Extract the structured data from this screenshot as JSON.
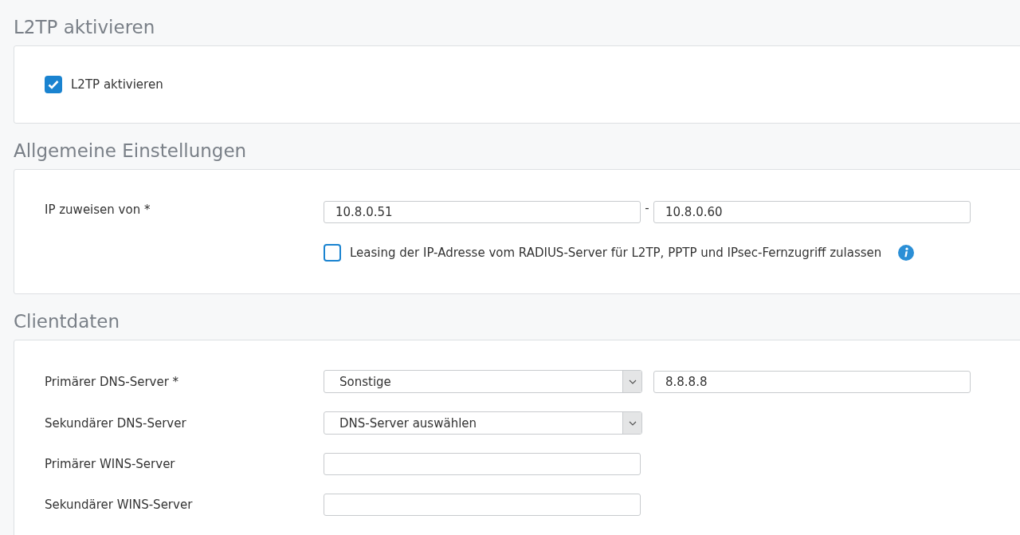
{
  "sections": [
    {
      "title": "L2TP aktivieren",
      "rows": [
        {
          "kind": "checkbox",
          "label": "L2TP aktivieren",
          "checked": true
        }
      ]
    },
    {
      "title": "Allgemeine Einstellungen",
      "rows": [
        {
          "kind": "range",
          "label": "IP zuweisen von *",
          "from": "10.8.0.51",
          "separator": "-",
          "to": "10.8.0.60"
        },
        {
          "kind": "option",
          "label": "Leasing der IP-Adresse vom RADIUS-Server für L2TP, PPTP und IPsec-Fernzugriff zulassen",
          "checked": false,
          "info": true
        }
      ]
    },
    {
      "title": "Clientdaten",
      "rows": [
        {
          "kind": "select",
          "label": "Primärer DNS-Server *",
          "value": "Sonstige",
          "extra": "8.8.8.8"
        },
        {
          "kind": "select",
          "label": "Sekundärer DNS-Server",
          "value": "DNS-Server auswählen"
        },
        {
          "kind": "text",
          "label": "Primärer WINS-Server"
        },
        {
          "kind": "text",
          "label": "Sekundärer WINS-Server"
        }
      ]
    }
  ]
}
